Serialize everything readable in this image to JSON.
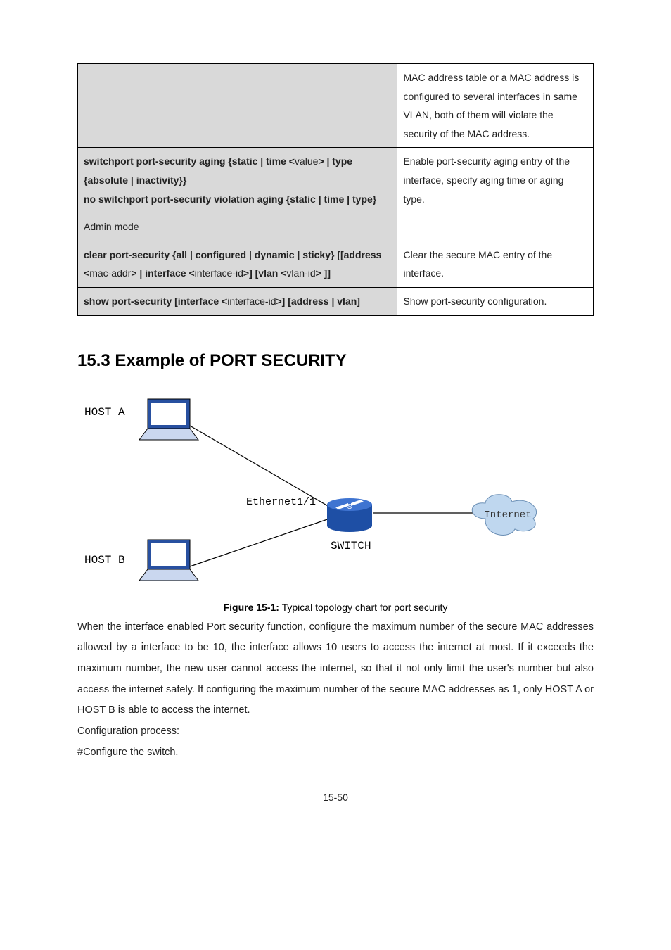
{
  "table": {
    "rows": [
      {
        "left_html": "",
        "right": "MAC address table or a MAC address is configured to several interfaces in same VLAN, both of them will violate the security of the MAC address."
      },
      {
        "left_html": "switchport port-security aging {static | time <<span class='g'>value</span>> | type {absolute | inactivity}}<br>no switchport port-security violation aging {static | time | type}",
        "right": "Enable port-security aging entry of the interface, specify aging time or aging type."
      },
      {
        "left_html": "<span class='nb'>Admin mode</span>",
        "right": ""
      },
      {
        "left_html": "clear port-security {all | configured | dynamic | sticky} [[address <<span class='g'>mac-addr</span>> | interface <<span class='g'>interface-id</span>>] [vlan <<span class='g'>vlan-id</span>> ]]",
        "right": "Clear the secure MAC entry of the interface."
      },
      {
        "left_html": "show port-security [interface <<span class='g'>interface-id</span>>] [address | vlan]",
        "right": "Show port-security configuration."
      }
    ]
  },
  "section_title": "15.3 Example of PORT SECURITY",
  "diagram": {
    "host_a": "HOST A",
    "host_b": "HOST B",
    "eth": "Ethernet1/1",
    "switch": "SWITCH",
    "internet": "Internet"
  },
  "caption": {
    "bold": "Figure 15-1:",
    "rest": " Typical topology chart for port security"
  },
  "paragraph": "When the interface enabled Port security function, configure the maximum number of the secure MAC addresses allowed by a interface to be 10, the interface allows 10 users to access the internet at most. If it exceeds the maximum number, the new user cannot access the internet, so that it not only limit the user's number but also access the internet safely. If configuring the maximum number of the secure MAC addresses as 1, only HOST A or HOST B is able to access the internet.",
  "cfg_proc": "Configuration process:",
  "cfg_switch": "#Configure the switch.",
  "footer": "15-50"
}
